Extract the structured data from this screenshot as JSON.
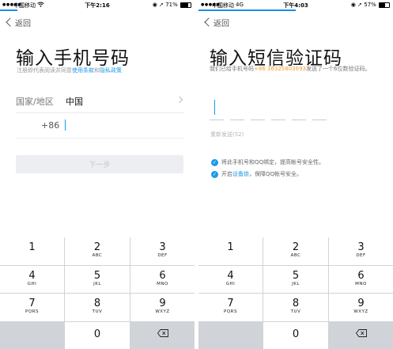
{
  "left": {
    "status": {
      "signal": "●●●●●",
      "carrier": "中国移动",
      "net_icon": "wifi",
      "time": "下午2:16",
      "battery_text": "71%",
      "battery_level": 0.71,
      "loading_progress": 0.09
    },
    "back_label": "返回",
    "title": "输入手机号码",
    "agreement": {
      "prefix": "注册即代表阅读并同意",
      "terms": "使用条款",
      "and": "和",
      "privacy": "隐私政策"
    },
    "country_label": "国家/地区",
    "country_value": "中国",
    "country_code": "+86",
    "phone_value": "",
    "next_label": "下一步"
  },
  "right": {
    "status": {
      "signal": "●●●●●",
      "carrier": "中国移动",
      "net": "4G",
      "time": "下午4:03",
      "battery_text": "57%",
      "battery_level": 0.57,
      "loading_progress": 0.5
    },
    "back_label": "返回",
    "title": "输入短信验证码",
    "desc_prefix": "我们已给手机号码",
    "desc_number": "+86 16325803693",
    "desc_suffix": "发送了一个6位数验证码。",
    "code_values": [
      "",
      "",
      "",
      "",
      "",
      ""
    ],
    "resend_label": "重新发送(52)",
    "tip1": "将此手机号和QQ绑定，提高帐号安全性。",
    "tip2_prefix": "开启",
    "tip2_link": "设备锁",
    "tip2_suffix": "，保障QQ帐号安全。"
  },
  "keypad": {
    "keys": [
      {
        "digit": "1",
        "letters": ""
      },
      {
        "digit": "2",
        "letters": "ABC"
      },
      {
        "digit": "3",
        "letters": "DEF"
      },
      {
        "digit": "4",
        "letters": "GHI"
      },
      {
        "digit": "5",
        "letters": "JKL"
      },
      {
        "digit": "6",
        "letters": "MNO"
      },
      {
        "digit": "7",
        "letters": "PQRS"
      },
      {
        "digit": "8",
        "letters": "TUV"
      },
      {
        "digit": "9",
        "letters": "WXYZ"
      },
      {
        "digit": "0",
        "letters": ""
      }
    ],
    "delete_icon": "backspace-icon"
  },
  "colors": {
    "accent": "#1a9be8",
    "highlight": "#f29b38",
    "keypad_bg": "#d0d3d8"
  }
}
